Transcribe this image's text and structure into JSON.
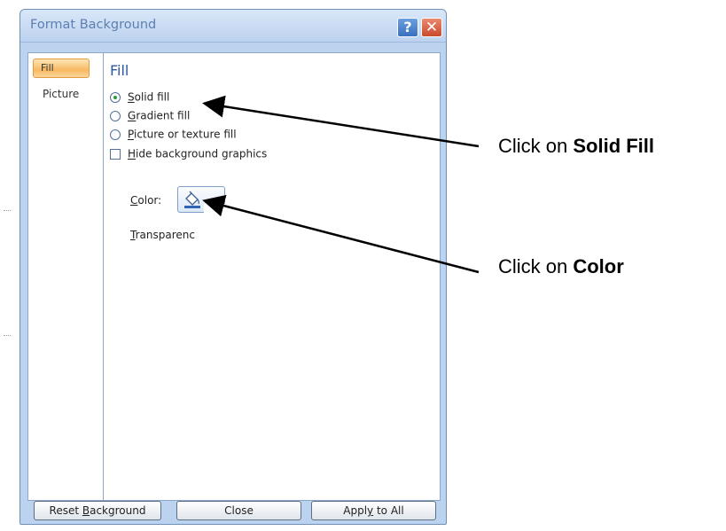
{
  "dialog": {
    "title": "Format Background",
    "help_glyph": "?",
    "close_glyph": "✕"
  },
  "nav": {
    "items": [
      {
        "label": "Fill",
        "selected": true
      },
      {
        "label": "Picture",
        "selected": false
      }
    ]
  },
  "fill": {
    "heading": "Fill",
    "options": [
      {
        "label": "Solid fill",
        "mnemonic": "S",
        "selected": true
      },
      {
        "label": "Gradient fill",
        "mnemonic": "G",
        "selected": false
      },
      {
        "label": "Picture or texture fill",
        "mnemonic": "P",
        "selected": false
      }
    ],
    "hide_graphics": {
      "label": "Hide background graphics",
      "mnemonic": "H",
      "checked": false
    },
    "color_label": "Color:",
    "transparency_label": "Transparenc"
  },
  "buttons": {
    "reset": "Reset Background",
    "close": "Close",
    "apply": "Apply to All"
  },
  "callouts": {
    "solid_prefix": "Click on ",
    "solid_bold": "Solid Fill",
    "color_prefix": "Click on ",
    "color_bold": "Color"
  },
  "colors": {
    "dialog_bg": "#bcd3ef",
    "title_text": "#5c7fb0",
    "heading_text": "#2c58a0",
    "selected_nav": "#f8b860"
  },
  "icons": [
    "help-icon",
    "close-icon",
    "paint-bucket-icon"
  ]
}
